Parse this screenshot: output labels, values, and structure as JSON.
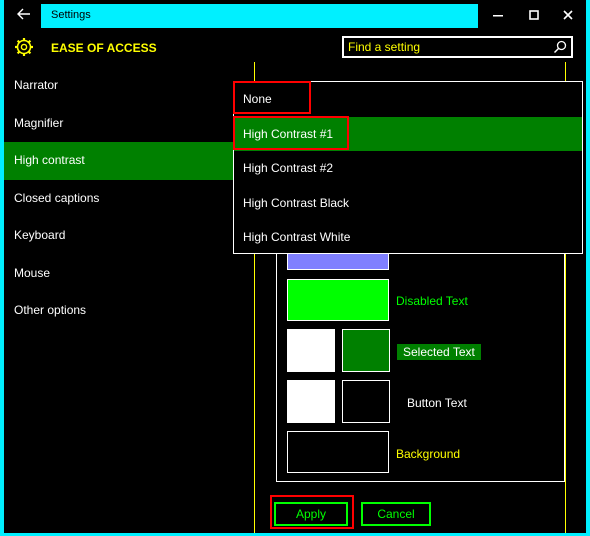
{
  "window": {
    "title": "Settings",
    "back_icon": "arrow-left-icon",
    "minimize_icon": "minimize-icon",
    "maximize_icon": "maximize-icon",
    "close_icon": "close-icon"
  },
  "header": {
    "title": "EASE OF ACCESS",
    "icon": "gear-icon",
    "search_placeholder": "Find a setting",
    "search_icon": "search-icon"
  },
  "sidebar": {
    "items": [
      {
        "label": "Narrator"
      },
      {
        "label": "Magnifier"
      },
      {
        "label": "High contrast",
        "active": true
      },
      {
        "label": "Closed captions"
      },
      {
        "label": "Keyboard"
      },
      {
        "label": "Mouse"
      },
      {
        "label": "Other options"
      }
    ]
  },
  "theme_dropdown": {
    "options": [
      "None",
      "High Contrast #1",
      "High Contrast #2",
      "High Contrast Black",
      "High Contrast White"
    ],
    "selected": "High Contrast #1"
  },
  "preview": {
    "hyperlinks_partial": "",
    "disabled_text": "Disabled Text",
    "selected_text": "Selected Text",
    "button_text": "Button Text",
    "background": "Background"
  },
  "actions": {
    "apply": "Apply",
    "cancel": "Cancel"
  },
  "colors": {
    "frame_accent": "#00f0ff",
    "hyperlink_swatch": "#8080ff",
    "disabled_text": "#00ff00",
    "selected_bg": "#008000",
    "text_yellow": "#ffff00",
    "highlight_red": "#ff0000"
  }
}
